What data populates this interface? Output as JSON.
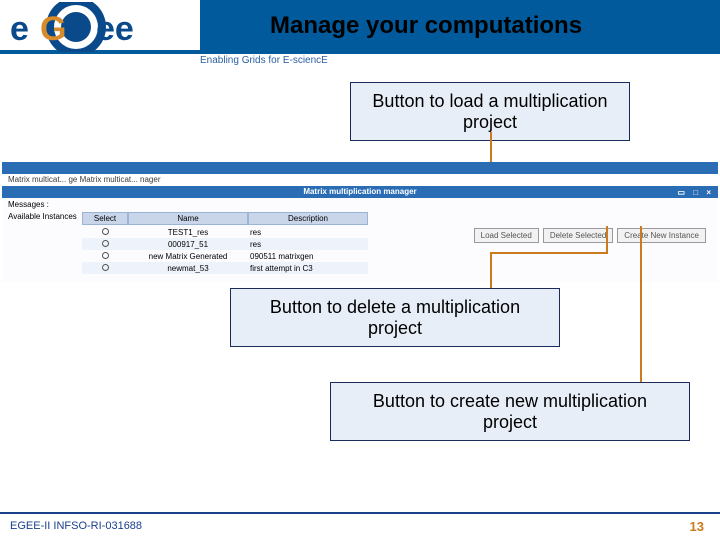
{
  "header": {
    "title": "Manage your computations",
    "tagline": "Enabling Grids for E-sciencE",
    "logo_text": "eGee"
  },
  "callouts": {
    "load": "Button to load a multiplication project",
    "delete": "Button to delete a multiplication project",
    "create": "Button to create new multiplication project"
  },
  "app": {
    "tabs_line": "Matrix multicat... ge   Matrix multicat... nager",
    "window_title": "Matrix multiplication manager",
    "messages_label": "Messages :",
    "available_label": "Available Instances",
    "columns": {
      "select": "Select",
      "name": "Name",
      "description": "Description"
    },
    "rows": [
      {
        "name": "TEST1_res",
        "desc": "res"
      },
      {
        "name": "000917_51",
        "desc": "res"
      },
      {
        "name": "new Matrix Generated",
        "desc": "090511 matrixgen"
      },
      {
        "name": "newmat_53",
        "desc": "first attempt in C3"
      }
    ],
    "buttons": {
      "load": "Load Selected",
      "delete": "Delete Selected",
      "create": "Create New Instance"
    }
  },
  "footer": {
    "left": "EGEE-II INFSO-RI-031688",
    "page": "13"
  }
}
